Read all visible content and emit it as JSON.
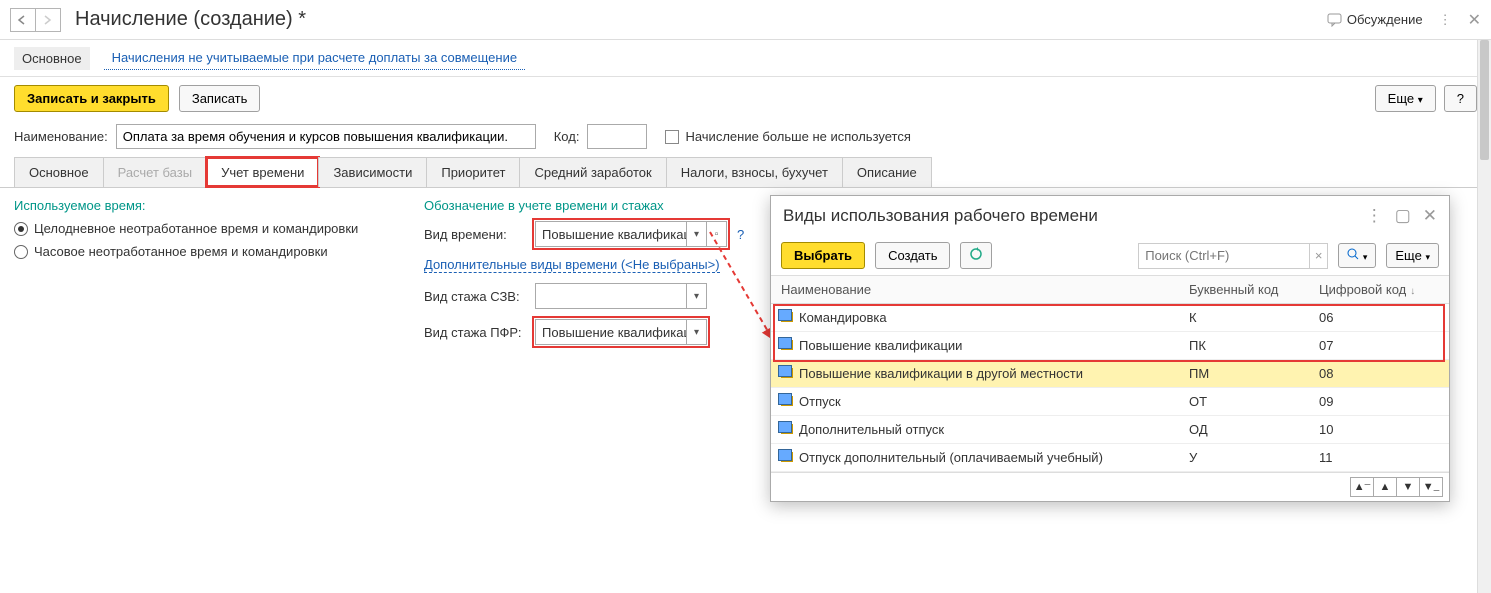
{
  "title": "Начисление (создание) *",
  "titlebar": {
    "discuss": "Обсуждение"
  },
  "sections": {
    "main": "Основное",
    "excluded": "Начисления не учитываемые при расчете доплаты за совмещение"
  },
  "toolbar": {
    "save_close": "Записать и закрыть",
    "save": "Записать",
    "more": "Еще",
    "help": "?"
  },
  "form": {
    "name_label": "Наименование:",
    "name_value": "Оплата за время обучения и курсов повышения квалификации.",
    "code_label": "Код:",
    "code_value": "",
    "unused_label": "Начисление больше не используется"
  },
  "tabs": [
    "Основное",
    "Расчет базы",
    "Учет времени",
    "Зависимости",
    "Приоритет",
    "Средний заработок",
    "Налоги, взносы, бухучет",
    "Описание"
  ],
  "left": {
    "title": "Используемое время:",
    "radio1": "Целодневное неотработанное время и командировки",
    "radio2": "Часовое неотработанное время и командировки"
  },
  "right": {
    "title": "Обозначение в учете времени и стажах",
    "time_type_label": "Вид времени:",
    "time_type_value": "Повышение квалификац",
    "extra_link": "Дополнительные виды времени (<Не выбраны>)",
    "szv_label": "Вид стажа СЗВ:",
    "szv_value": "",
    "pfr_label": "Вид стажа ПФР:",
    "pfr_value": "Повышение квалификац"
  },
  "popup": {
    "title": "Виды использования рабочего времени",
    "select": "Выбрать",
    "create": "Создать",
    "search_placeholder": "Поиск (Ctrl+F)",
    "more": "Еще",
    "columns": {
      "name": "Наименование",
      "letter": "Буквенный код",
      "digit": "Цифровой код"
    },
    "rows": [
      {
        "name": "Командировка",
        "letter": "К",
        "digit": "06"
      },
      {
        "name": "Повышение квалификации",
        "letter": "ПК",
        "digit": "07"
      },
      {
        "name": "Повышение квалификации в другой местности",
        "letter": "ПМ",
        "digit": "08"
      },
      {
        "name": "Отпуск",
        "letter": "ОТ",
        "digit": "09"
      },
      {
        "name": "Дополнительный отпуск",
        "letter": "ОД",
        "digit": "10"
      },
      {
        "name": "Отпуск дополнительный (оплачиваемый учебный)",
        "letter": "У",
        "digit": "11"
      }
    ]
  }
}
